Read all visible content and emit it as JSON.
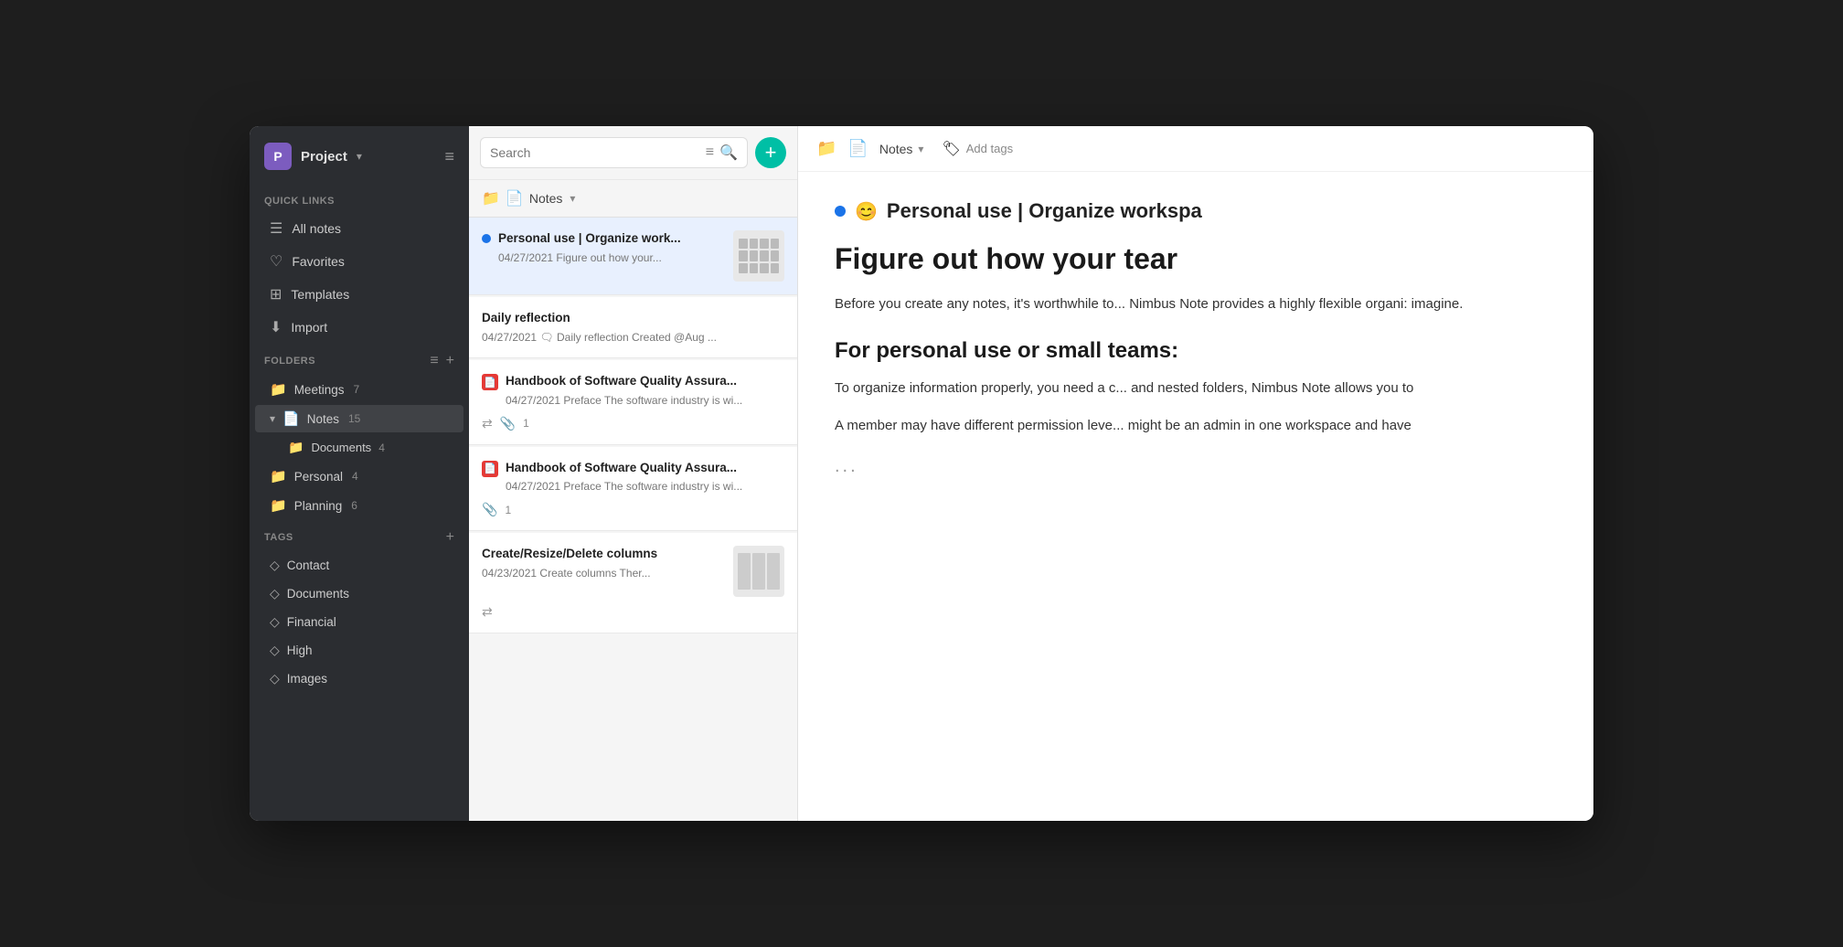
{
  "workspace": {
    "avatar_letter": "P",
    "name": "Project",
    "chevron": "▾"
  },
  "sidebar": {
    "quick_links_label": "Quick Links",
    "items": [
      {
        "id": "all-notes",
        "icon": "☰",
        "label": "All notes"
      },
      {
        "id": "favorites",
        "icon": "♡",
        "label": "Favorites"
      },
      {
        "id": "templates",
        "icon": "⊞",
        "label": "Templates"
      },
      {
        "id": "import",
        "icon": "⬇",
        "label": "Import"
      }
    ],
    "folders_label": "Folders",
    "folders": [
      {
        "id": "meetings",
        "label": "Meetings",
        "count": "7",
        "icon": "📁",
        "level": 0
      },
      {
        "id": "notes",
        "label": "Notes",
        "count": "15",
        "icon": "📄",
        "level": 0,
        "active": true
      },
      {
        "id": "documents",
        "label": "Documents",
        "count": "4",
        "icon": "📁",
        "level": 1
      },
      {
        "id": "personal",
        "label": "Personal",
        "count": "4",
        "icon": "📁",
        "level": 0
      },
      {
        "id": "planning",
        "label": "Planning",
        "count": "6",
        "icon": "📁",
        "level": 0
      }
    ],
    "tags_label": "Tags",
    "tags": [
      {
        "id": "contact",
        "label": "Contact"
      },
      {
        "id": "documents",
        "label": "Documents"
      },
      {
        "id": "financial",
        "label": "Financial"
      },
      {
        "id": "high",
        "label": "High"
      },
      {
        "id": "images",
        "label": "Images"
      }
    ]
  },
  "notes_panel": {
    "search_placeholder": "Search",
    "folder_name": "Notes",
    "notes": [
      {
        "id": "note1",
        "active": true,
        "has_dot": true,
        "has_red_icon": false,
        "title": "Personal use | Organize work...",
        "date": "04/27/2021",
        "preview": "Figure out how your...",
        "has_thumbnail": true,
        "has_attach": false,
        "attach_count": ""
      },
      {
        "id": "note2",
        "active": false,
        "has_dot": false,
        "has_red_icon": false,
        "title": "Daily reflection",
        "date": "04/27/2021",
        "preview": "🗨 Daily reflection Created @Aug ...",
        "has_thumbnail": false,
        "has_attach": false,
        "attach_count": ""
      },
      {
        "id": "note3",
        "active": false,
        "has_dot": false,
        "has_red_icon": true,
        "title": "Handbook of Software Quality Assura...",
        "date": "04/27/2021",
        "preview": "Preface The software industry is wi...",
        "has_thumbnail": false,
        "has_attach": true,
        "attach_count": "1"
      },
      {
        "id": "note4",
        "active": false,
        "has_dot": false,
        "has_red_icon": true,
        "title": "Handbook of Software Quality Assura...",
        "date": "04/27/2021",
        "preview": "Preface The software industry is wi...",
        "has_thumbnail": false,
        "has_attach": true,
        "attach_count": "1"
      },
      {
        "id": "note5",
        "active": false,
        "has_dot": false,
        "has_red_icon": false,
        "title": "Create/Resize/Delete columns",
        "date": "04/23/2021",
        "preview": "Create columns Ther...",
        "has_thumbnail": true,
        "has_attach": false,
        "attach_count": ""
      }
    ]
  },
  "main_content": {
    "toolbar": {
      "folder_icon": "📁",
      "note_icon": "📄",
      "breadcrumb_label": "Notes",
      "breadcrumb_chevron": "▾",
      "tag_icon": "🏷",
      "add_tags_label": "Add tags"
    },
    "note": {
      "status_color": "#1a73e8",
      "emoji": "😊",
      "header_title": "Personal use | Organize workspa",
      "h1": "Figure out how your tear",
      "paragraph1": "Before you create any notes, it's worthwhile to... Nimbus Note provides a highly flexible organi: imagine.",
      "h2": "For personal use or small teams:",
      "paragraph2": "To organize information properly, you need a c... and nested folders, Nimbus Note allows you to",
      "paragraph3": "A member may have different permission leve... might be an admin in one workspace and have",
      "ellipsis": "..."
    }
  }
}
